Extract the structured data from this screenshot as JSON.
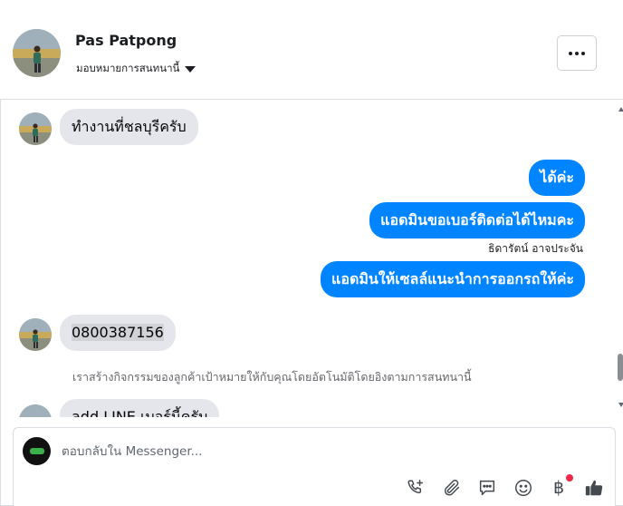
{
  "header": {
    "contact_name": "Pas Patpong",
    "assign_label": "มอบหมายการสนทนานี้"
  },
  "messages": [
    {
      "direction": "in",
      "text": "ทำงานที่ชลบุรีครับ"
    },
    {
      "direction": "out",
      "text": "ได้ค่ะ"
    },
    {
      "direction": "out",
      "text": "แอดมินขอเบอร์ติดต่อได้ไหมคะ"
    },
    {
      "direction": "out_label",
      "text": "ธิดารัตน์ อาจประจัน"
    },
    {
      "direction": "out",
      "text": "แอดมินให้เซลล์แนะนำการออกรถให้ค่ะ"
    },
    {
      "direction": "in",
      "text": "0800387156"
    },
    {
      "direction": "system",
      "text": "เราสร้างกิจกรรมของลูกค้าเป้าหมายให้กับคุณโดยอัตโนมัติโดยอิงตามการสนทนานี้"
    },
    {
      "direction": "in",
      "text": "add LINE เบอร์นี้ครับ"
    }
  ],
  "composer": {
    "placeholder": "ตอบกลับใน Messenger...",
    "icons": [
      "phone-plus-icon",
      "paperclip-icon",
      "saved-reply-icon",
      "emoji-icon",
      "baht-payment-icon",
      "thumbs-up-icon"
    ],
    "baht_symbol": "฿"
  },
  "colors": {
    "outgoing_bubble": "#0084ff",
    "incoming_bubble": "#e4e6eb",
    "notification_dot": "#f02849"
  }
}
